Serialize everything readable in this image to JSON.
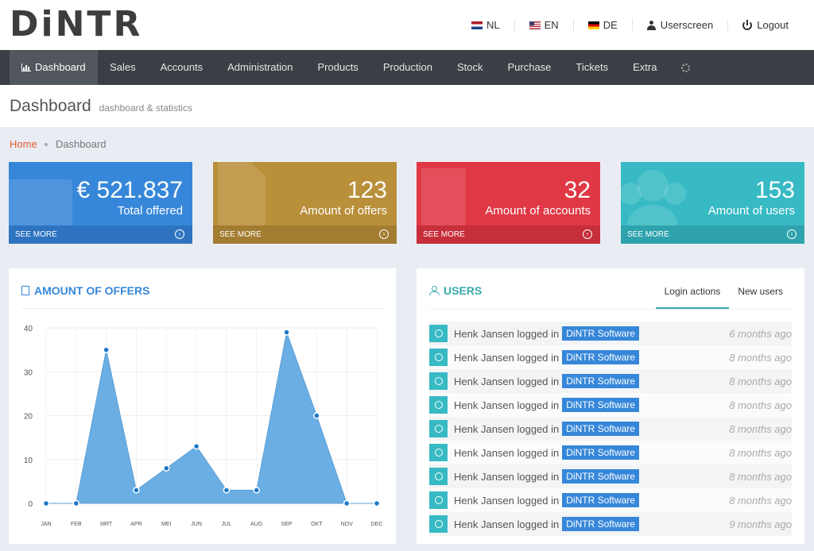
{
  "header": {
    "logo": "DiNTR",
    "links": [
      {
        "label": "NL",
        "icon": "flag-nl-icon"
      },
      {
        "label": "EN",
        "icon": "flag-en-icon"
      },
      {
        "label": "DE",
        "icon": "flag-de-icon"
      },
      {
        "label": "Userscreen",
        "icon": "user-icon"
      },
      {
        "label": "Logout",
        "icon": "power-icon"
      }
    ]
  },
  "nav": {
    "items": [
      "Dashboard",
      "Sales",
      "Accounts",
      "Administration",
      "Products",
      "Production",
      "Stock",
      "Purchase",
      "Tickets",
      "Extra"
    ],
    "active": "Dashboard"
  },
  "page": {
    "title": "Dashboard",
    "subtitle": "dashboard & statistics"
  },
  "breadcrumb": {
    "home": "Home",
    "current": "Dashboard"
  },
  "tiles": [
    {
      "value": "€ 521.837",
      "label": "Total offered",
      "more": "SEE MORE",
      "color": "#3687d9"
    },
    {
      "value": "123",
      "label": "Amount of offers",
      "more": "SEE MORE",
      "color": "#b98f3a"
    },
    {
      "value": "32",
      "label": "Amount of accounts",
      "more": "SEE MORE",
      "color": "#e03845"
    },
    {
      "value": "153",
      "label": "Amount of users",
      "more": "SEE MORE",
      "color": "#37bac4"
    }
  ],
  "offers_panel": {
    "title": "AMOUNT OF OFFERS"
  },
  "users_panel": {
    "title": "USERS",
    "tabs": [
      "Login actions",
      "New users"
    ],
    "active_tab": "Login actions",
    "rows": [
      {
        "text": "Henk Jansen logged in",
        "tag": "DiNTR Software",
        "ago": "6 months ago"
      },
      {
        "text": "Henk Jansen logged in",
        "tag": "DiNTR Software",
        "ago": "8 months ago"
      },
      {
        "text": "Henk Jansen logged in",
        "tag": "DiNTR Software",
        "ago": "8 months ago"
      },
      {
        "text": "Henk Jansen logged in",
        "tag": "DiNTR Software",
        "ago": "8 months ago"
      },
      {
        "text": "Henk Jansen logged in",
        "tag": "DiNTR Software",
        "ago": "8 months ago"
      },
      {
        "text": "Henk Jansen logged in",
        "tag": "DiNTR Software",
        "ago": "8 months ago"
      },
      {
        "text": "Henk Jansen logged in",
        "tag": "DiNTR Software",
        "ago": "8 months ago"
      },
      {
        "text": "Henk Jansen logged in",
        "tag": "DiNTR Software",
        "ago": "8 months ago"
      },
      {
        "text": "Henk Jansen logged in",
        "tag": "DiNTR Software",
        "ago": "9 months ago"
      }
    ]
  },
  "chart_data": {
    "type": "area",
    "title": "",
    "categories": [
      "JAN",
      "FEB",
      "MRT",
      "APR",
      "MEI",
      "JUN",
      "JUL",
      "AUG",
      "SEP",
      "OKT",
      "NOV",
      "DEC"
    ],
    "values": [
      0,
      0,
      35,
      3,
      8,
      13,
      3,
      3,
      39,
      20,
      0,
      0
    ],
    "yticks": [
      0,
      10,
      20,
      30,
      40
    ],
    "ylim": [
      0,
      40
    ],
    "grid": true,
    "color": "#6aaee3"
  }
}
